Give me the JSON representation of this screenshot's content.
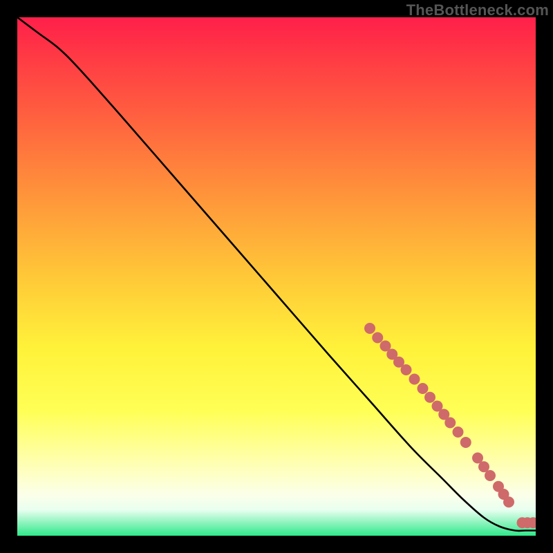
{
  "watermark": "TheBottleneck.com",
  "chart_data": {
    "type": "line",
    "title": "",
    "xlabel": "",
    "ylabel": "",
    "xlim": [
      0,
      100
    ],
    "ylim": [
      0,
      100
    ],
    "series": [
      {
        "name": "curve",
        "x": [
          0,
          4,
          8,
          12,
          20,
          30,
          40,
          50,
          60,
          68,
          76,
          82,
          86,
          90,
          93,
          96,
          98,
          100
        ],
        "y": [
          100,
          97,
          94,
          90,
          81,
          69.5,
          58,
          46.5,
          35,
          26,
          17,
          11,
          7,
          3.5,
          1.8,
          1,
          1,
          1
        ]
      }
    ],
    "markers": [
      {
        "x": 68.0,
        "y": 40.0
      },
      {
        "x": 69.5,
        "y": 38.2
      },
      {
        "x": 71.0,
        "y": 36.6
      },
      {
        "x": 72.3,
        "y": 35.0
      },
      {
        "x": 73.6,
        "y": 33.5
      },
      {
        "x": 75.0,
        "y": 32.0
      },
      {
        "x": 76.6,
        "y": 30.2
      },
      {
        "x": 78.2,
        "y": 28.4
      },
      {
        "x": 79.6,
        "y": 26.7
      },
      {
        "x": 81.0,
        "y": 25.0
      },
      {
        "x": 82.3,
        "y": 23.4
      },
      {
        "x": 83.5,
        "y": 21.8
      },
      {
        "x": 85.0,
        "y": 20.0
      },
      {
        "x": 86.5,
        "y": 18.0
      },
      {
        "x": 88.8,
        "y": 15.0
      },
      {
        "x": 90.0,
        "y": 13.3
      },
      {
        "x": 91.2,
        "y": 11.6
      },
      {
        "x": 92.8,
        "y": 9.5
      },
      {
        "x": 93.8,
        "y": 8.0
      },
      {
        "x": 94.8,
        "y": 6.5
      },
      {
        "x": 97.4,
        "y": 2.5
      },
      {
        "x": 98.4,
        "y": 2.5
      },
      {
        "x": 99.5,
        "y": 2.5
      }
    ],
    "gradient_stops": [
      {
        "pos": 0.0,
        "color": "#ff1f4a"
      },
      {
        "pos": 0.08,
        "color": "#ff3b44"
      },
      {
        "pos": 0.22,
        "color": "#ff6a3e"
      },
      {
        "pos": 0.36,
        "color": "#ff9a3a"
      },
      {
        "pos": 0.5,
        "color": "#ffc838"
      },
      {
        "pos": 0.64,
        "color": "#fff23a"
      },
      {
        "pos": 0.76,
        "color": "#ffff56"
      },
      {
        "pos": 0.85,
        "color": "#ffffa8"
      },
      {
        "pos": 0.92,
        "color": "#fcffe8"
      },
      {
        "pos": 0.95,
        "color": "#e9fff0"
      },
      {
        "pos": 1.0,
        "color": "#2fe98a"
      }
    ],
    "marker_color": "#cf6a6a",
    "line_color": "#000000"
  }
}
